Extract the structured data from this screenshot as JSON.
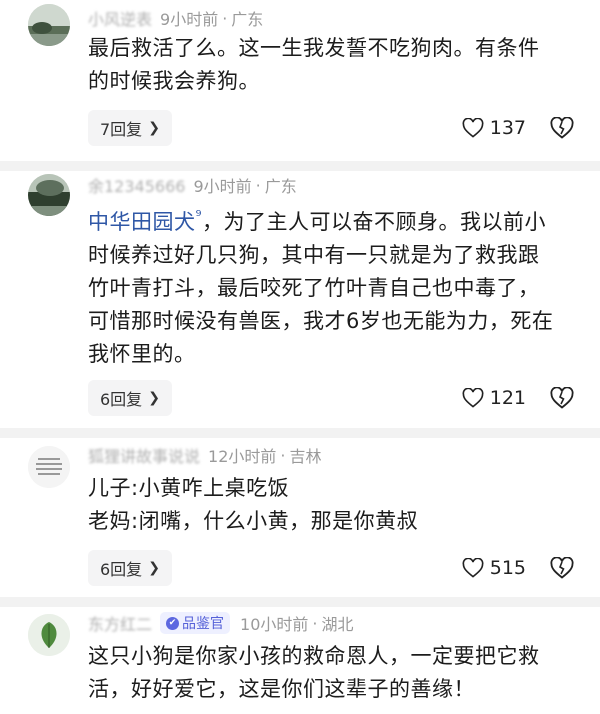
{
  "comments": [
    {
      "username": "小风逆表",
      "time": "9小时前",
      "location": "广东",
      "text": "最后救活了么。这一生我发誓不吃狗肉。有条件的时候我会养狗。",
      "replies": "7回复",
      "likes": "137"
    },
    {
      "username": "余12345666",
      "time": "9小时前",
      "location": "广东",
      "mention": "中华田园犬",
      "text": "，为了主人可以奋不顾身。我以前小时候养过好几只狗，其中有一只就是为了救我跟竹叶青打斗，最后咬死了竹叶青自己也中毒了，可惜那时候没有兽医，我才6岁也无能为力，死在我怀里的。",
      "replies": "6回复",
      "likes": "121"
    },
    {
      "username": "狐狸讲故事说说",
      "time": "12小时前",
      "location": "吉林",
      "line1": "儿子:小黄咋上桌吃饭",
      "line2": "老妈:闭嘴，什么小黄，那是你黄叔",
      "replies": "6回复",
      "likes": "515"
    },
    {
      "username": "东方红二",
      "badge": "品鉴官",
      "time": "10小时前",
      "location": "湖北",
      "text": "这只小狗是你家小孩的救命恩人，一定要把它救活，好好爱它，这是你们这辈子的善缘！"
    }
  ],
  "icons": {
    "heart": "heart-icon",
    "dislike": "broken-heart-icon",
    "chevron": "chevron-right-icon"
  }
}
